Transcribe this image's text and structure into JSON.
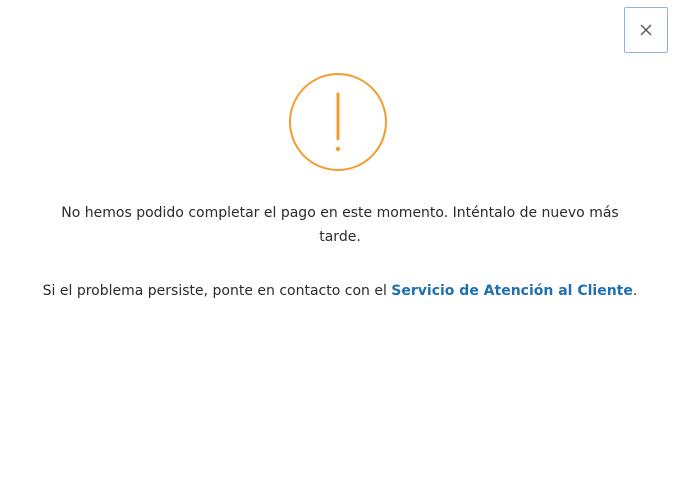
{
  "dialog": {
    "close_icon": "close-icon",
    "alert_icon": "exclamation-circle-icon",
    "accent_color": "#f29d2e",
    "link_color": "#1f6fb2",
    "message": "No hemos podido completar el pago en este momento. Inténtalo de nuevo más tarde.",
    "contact_prefix": "Si el problema persiste, ponte en contacto con el ",
    "contact_link": "Servicio de Atención al Cliente",
    "contact_suffix": "."
  }
}
